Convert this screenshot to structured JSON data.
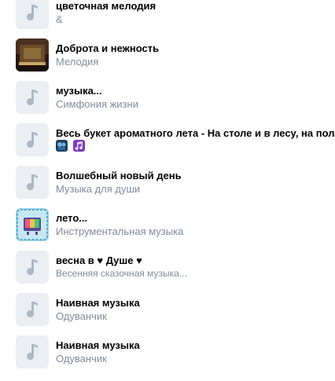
{
  "tracks": [
    {
      "title": "цветочная мелодия",
      "artist": "&",
      "cover": "music-note-icon"
    },
    {
      "title": "Доброта и нежность",
      "artist": "Мелодия",
      "cover": "album-art"
    },
    {
      "title": "музыка...",
      "artist": "Симфония жизни",
      "cover": "music-note-icon"
    },
    {
      "title": "Весь букет ароматного лета - На столе и в лесу, на полях,",
      "artist": "",
      "cover": "music-note-icon",
      "artist_emoji": [
        "film-projector-emoji",
        "musical-notes-emoji"
      ]
    },
    {
      "title": "Волшебный новый день",
      "artist": "Музыка для души",
      "cover": "music-note-icon"
    },
    {
      "title": "лето...",
      "artist": "Инструментальная музыка",
      "cover": "album-art"
    },
    {
      "title": "весна в ♥ Душе ♥",
      "artist": "Весенняя сказочная музыка...",
      "cover": "music-note-icon"
    },
    {
      "title": "Наивная музыка",
      "artist": "Одуванчик",
      "cover": "music-note-icon"
    },
    {
      "title": "Наивная музыка",
      "artist": "Одуванчик",
      "cover": "music-note-icon"
    }
  ],
  "colors": {
    "placeholder_bg": "#ebeef2",
    "note_icon": "#aeb7c2",
    "subtitle": "#818c99"
  }
}
